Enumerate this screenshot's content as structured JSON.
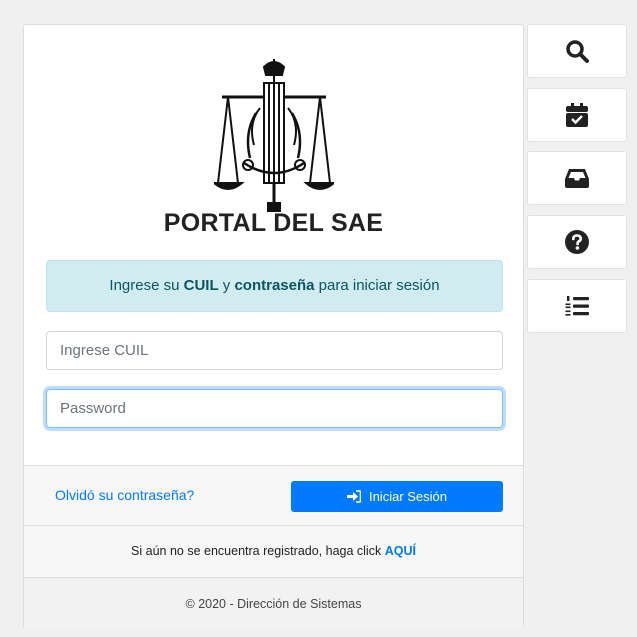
{
  "portal": {
    "title": "PORTAL DEL SAE"
  },
  "alert": {
    "prefix": "Ingrese su ",
    "cuil": "CUIL",
    "middle": " y ",
    "password": "contraseña",
    "suffix": " para iniciar sesión"
  },
  "form": {
    "cuil_placeholder": "Ingrese CUIL",
    "cuil_value": "",
    "password_placeholder": "Password",
    "password_value": ""
  },
  "actions": {
    "forgot_label": "Olvidó su contraseña?",
    "login_label": "Iniciar Sesión"
  },
  "register": {
    "text": "Si aún no se encuentra registrado, haga click ",
    "link": "AQUÍ"
  },
  "footer": {
    "copyright": "© 2020 - Dirección de Sistemas"
  },
  "sidebar": {
    "items": [
      {
        "icon": "search-icon"
      },
      {
        "icon": "calendar-check-icon"
      },
      {
        "icon": "inbox-icon"
      },
      {
        "icon": "question-circle-icon"
      },
      {
        "icon": "numbered-list-icon"
      }
    ]
  },
  "colors": {
    "primary": "#007bff",
    "alert_bg": "#d1ecf1",
    "alert_text": "#0c5460",
    "icon": "#222222"
  }
}
